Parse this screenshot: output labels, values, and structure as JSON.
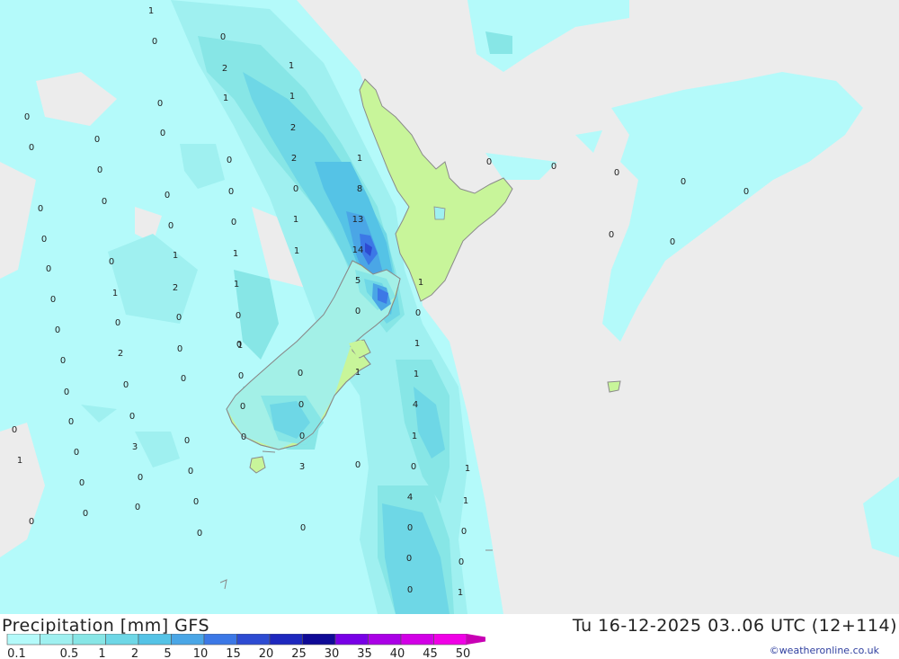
{
  "title": "Precipitation [mm] GFS",
  "datetime": "Tu 16-12-2025 03..06 UTC (12+114)",
  "credit": "©weatheronline.co.uk",
  "colors": {
    "background": "#ececec",
    "land": "#c8f59a",
    "coast": "#8a8a8a",
    "levels": [
      "#b4fafa",
      "#9ff0f0",
      "#87e6e6",
      "#6ed7e6",
      "#55c3e6",
      "#4aa6e6",
      "#3c78e6",
      "#2d4bd2",
      "#1e28be",
      "#0f0a96",
      "#7800e6",
      "#aa00e6",
      "#d200e6",
      "#f000e6",
      "#c800b4",
      "#a00096"
    ]
  },
  "legend": {
    "colors": [
      "#b4fafa",
      "#9ff0f0",
      "#87e6e6",
      "#6ed7e6",
      "#55c3e6",
      "#4aa6e6",
      "#3c78e6",
      "#2d4bd2",
      "#1e28be",
      "#0f0a96",
      "#7800e6",
      "#aa00e6",
      "#d200e6",
      "#f000e6"
    ],
    "labels": [
      "0.1",
      "0.5",
      "1",
      "2",
      "5",
      "10",
      "15",
      "20",
      "25",
      "30",
      "35",
      "40",
      "45",
      "50"
    ]
  },
  "map_labels": [
    "1",
    "0",
    "0",
    "2",
    "1",
    "1",
    "1",
    "0",
    "2",
    "0",
    "0",
    "0",
    "2",
    "0",
    "0",
    "0",
    "1",
    "0",
    "0",
    "8",
    "0",
    "0",
    "0",
    "0",
    "0",
    "13",
    "0",
    "0",
    "0",
    "1",
    "14",
    "0",
    "0",
    "0",
    "1",
    "0",
    "5",
    "0",
    "1",
    "1",
    "0",
    "1",
    "0",
    "1",
    "0",
    "2",
    "1",
    "0",
    "0",
    "0",
    "1",
    "0",
    "0",
    "0",
    "1",
    "1",
    "0",
    "2",
    "0",
    "0",
    "1",
    "4",
    "0",
    "0",
    "0",
    "0",
    "0",
    "0",
    "0",
    "0",
    "0",
    "1",
    "0",
    "0",
    "0",
    "1",
    "3",
    "0",
    "0",
    "0",
    "4",
    "1",
    "0",
    "3",
    "1",
    "0",
    "0",
    "0",
    "0",
    "0",
    "0",
    "0",
    "0",
    "0",
    "0",
    "0",
    "0",
    "0",
    "1",
    "0"
  ]
}
